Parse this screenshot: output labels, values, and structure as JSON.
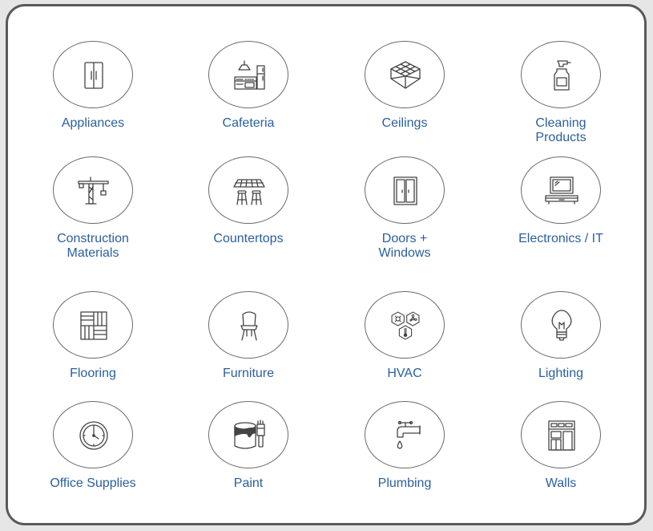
{
  "accent_color": "#2b5f9e",
  "categories": [
    {
      "label": "Appliances",
      "icon": "refrigerator-icon"
    },
    {
      "label": "Cafeteria",
      "icon": "kitchen-icon"
    },
    {
      "label": "Ceilings",
      "icon": "ceiling-tiles-icon"
    },
    {
      "label": "Cleaning\nProducts",
      "icon": "spray-bottle-icon"
    },
    {
      "label": "Construction\nMaterials",
      "icon": "crane-icon"
    },
    {
      "label": "Countertops",
      "icon": "countertop-stools-icon"
    },
    {
      "label": "Doors +\nWindows",
      "icon": "double-door-icon"
    },
    {
      "label": "Electronics / IT",
      "icon": "computer-icon"
    },
    {
      "label": "Flooring",
      "icon": "floor-tiles-icon"
    },
    {
      "label": "Furniture",
      "icon": "chair-icon"
    },
    {
      "label": "HVAC",
      "icon": "hvac-hexagons-icon"
    },
    {
      "label": "Lighting",
      "icon": "light-bulb-icon"
    },
    {
      "label": "Office Supplies",
      "icon": "wall-clock-icon"
    },
    {
      "label": "Paint",
      "icon": "paint-can-brush-icon"
    },
    {
      "label": "Plumbing",
      "icon": "faucet-icon"
    },
    {
      "label": "Walls",
      "icon": "building-wall-icon"
    }
  ]
}
